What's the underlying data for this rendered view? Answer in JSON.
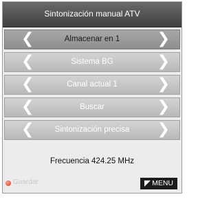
{
  "header": {
    "title": "Sintonización manual ATV"
  },
  "menu_rows": [
    {
      "label": "Almacenar en 1",
      "selected": true
    },
    {
      "label": "Sistema BG",
      "selected": false
    },
    {
      "label": "Canal actual 1",
      "selected": false
    },
    {
      "label": "Buscar",
      "selected": false
    },
    {
      "label": "Sintonización precisa",
      "selected": false
    }
  ],
  "arrows": {
    "left": "❮",
    "right": "❯"
  },
  "frequency": {
    "text": "Frecuencia 424.25  MHz"
  },
  "footer": {
    "save_label": "Guardar",
    "menu_label": "MENU"
  },
  "colors": {
    "header_bg": "#4f4f4f",
    "selected_row_bg": "#9b9b9b",
    "row_bg": "#c6c6c6",
    "save_dot": "#e05a40"
  }
}
